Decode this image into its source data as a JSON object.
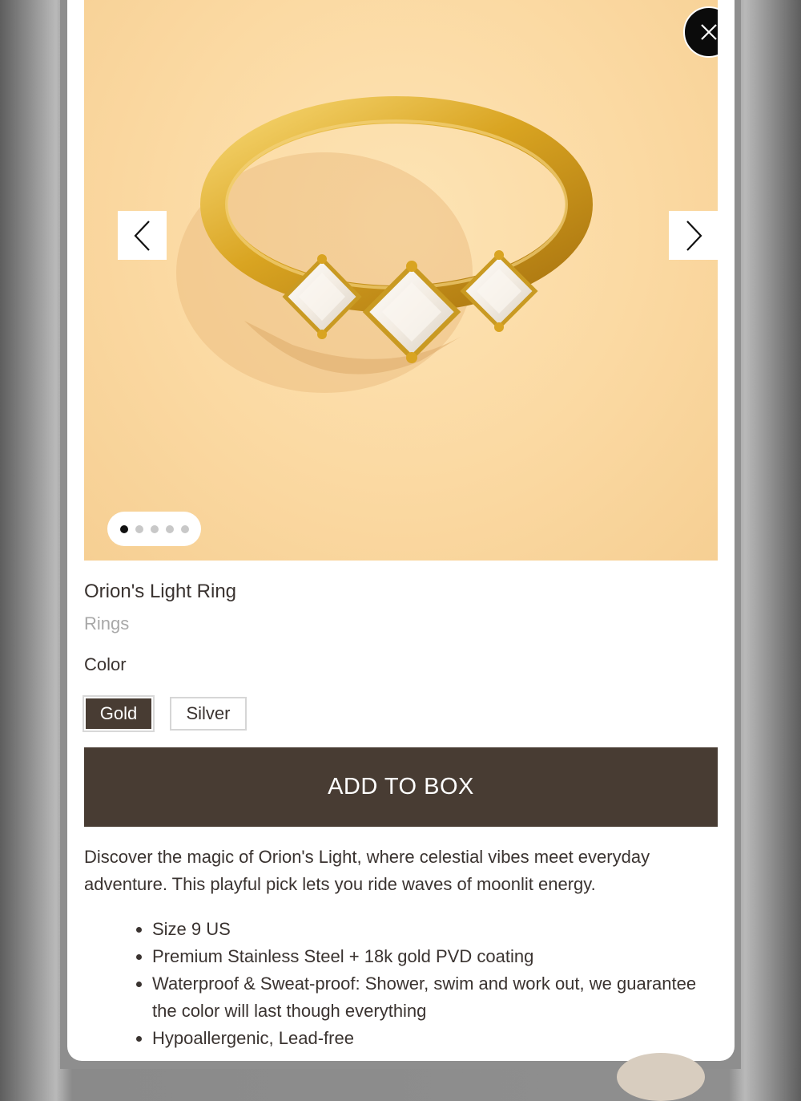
{
  "modal": {
    "close_icon": "close-icon",
    "gallery": {
      "prev_icon": "chevron-left-icon",
      "next_icon": "chevron-right-icon",
      "dot_count": 5,
      "active_dot": 1
    },
    "product": {
      "title": "Orion's Light Ring",
      "category": "Rings",
      "color_label": "Color",
      "color_options": [
        "Gold",
        "Silver"
      ],
      "selected_color": "Gold",
      "add_button_label": "ADD TO BOX",
      "description": "Discover the magic of Orion's Light, where celestial vibes meet everyday adventure. This playful pick lets you ride waves of moonlit energy.",
      "features": [
        "Size 9 US",
        "Premium Stainless Steel + 18k gold PVD coating",
        "Waterproof & Sweat-proof: Shower, swim and work out, we guarantee the color will last though everything",
        "Hypoallergenic, Lead-free"
      ]
    }
  },
  "colors": {
    "accent": "#483c33",
    "text": "#3a3330",
    "muted": "#a8a8a8",
    "gallery_bg": "#fbd9a2"
  }
}
